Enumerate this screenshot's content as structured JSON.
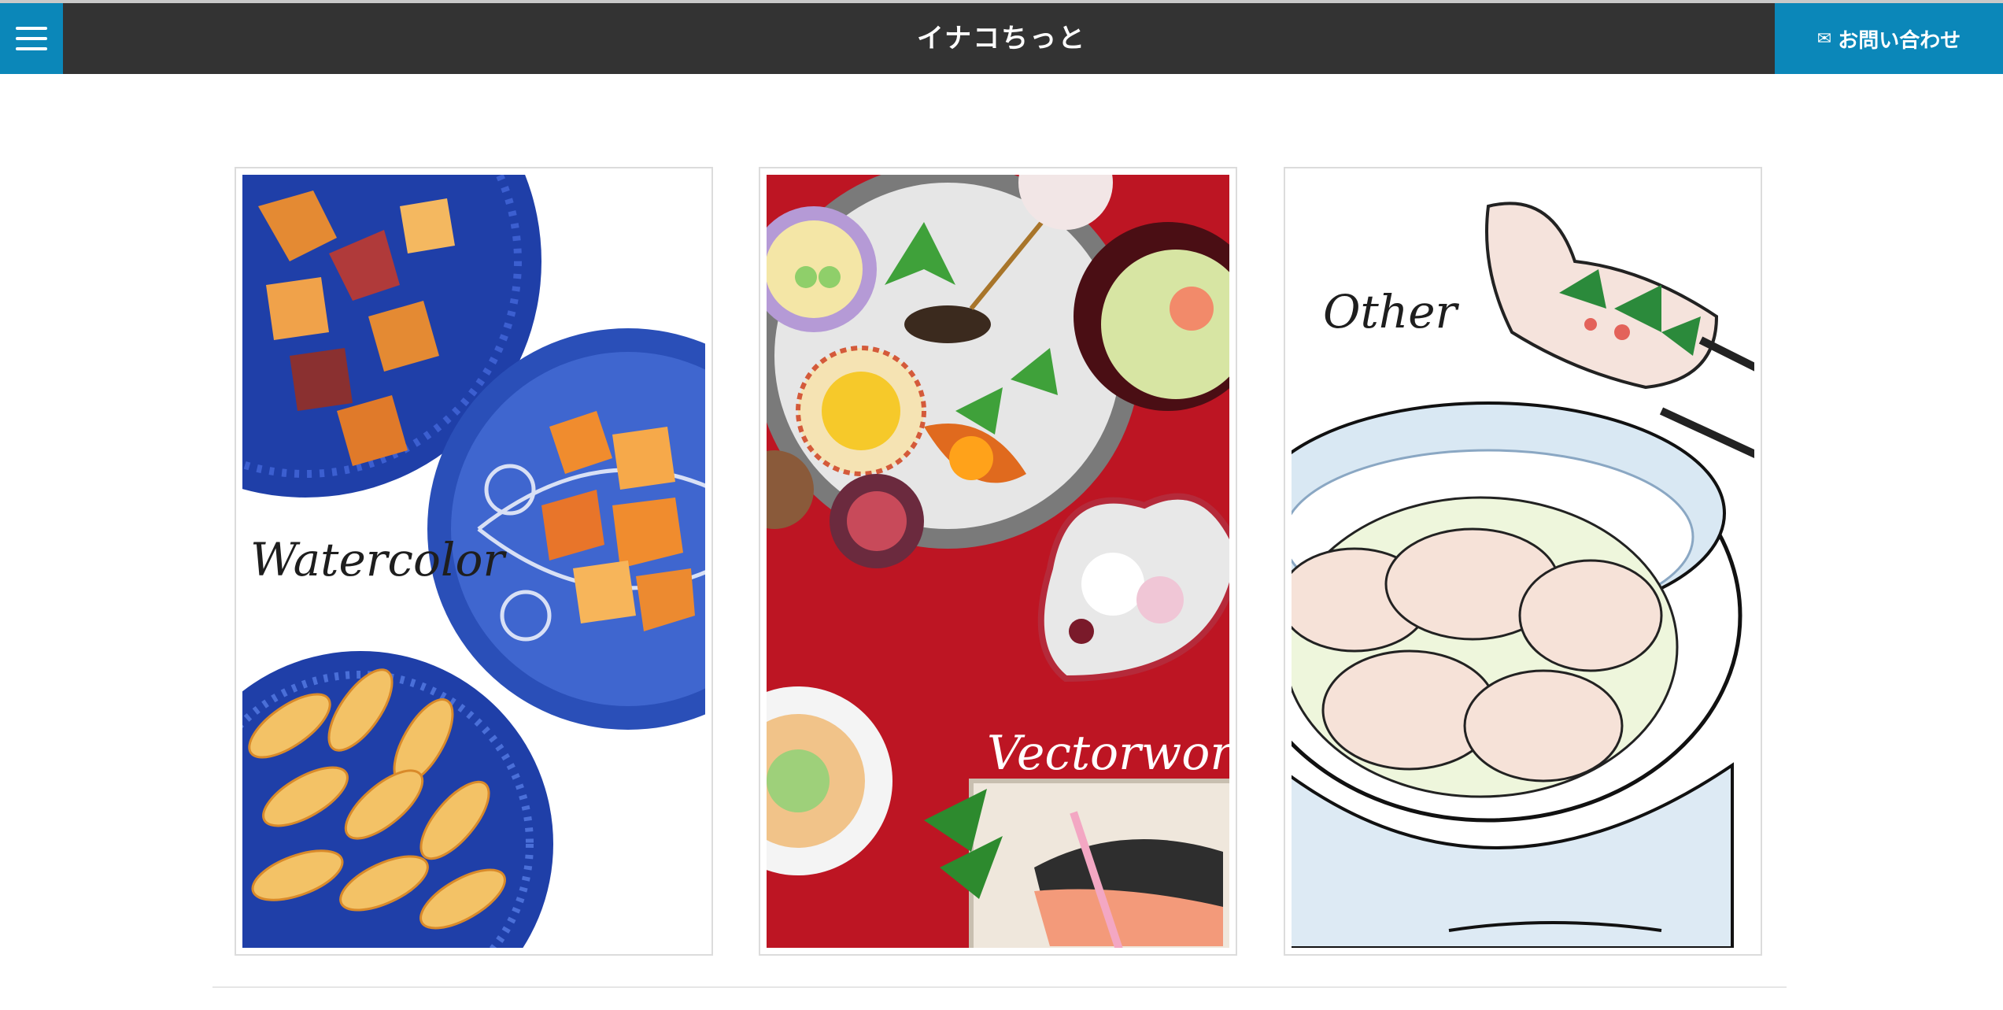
{
  "header": {
    "title": "イナコちっと",
    "contact_label": "お問い合わせ",
    "contact_icon": "mail-icon",
    "menu_icon": "hamburger-icon"
  },
  "colors": {
    "accent": "#0b87b9",
    "header_bg": "#333333"
  },
  "cards": [
    {
      "label": "Watercolor"
    },
    {
      "label": "Vectorwork"
    },
    {
      "label": "Other"
    }
  ]
}
